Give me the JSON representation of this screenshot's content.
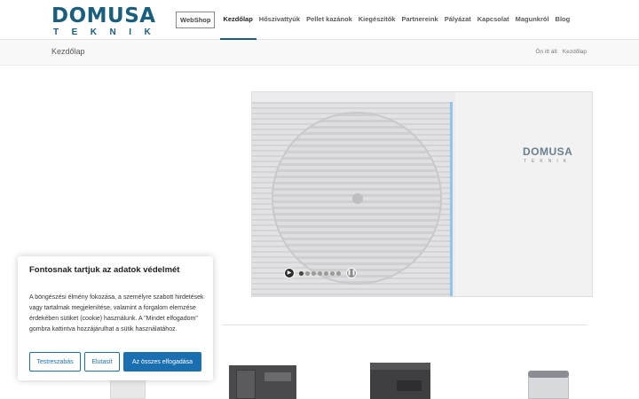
{
  "logo": {
    "main": "DOMUSA",
    "sub": "TEKNIK"
  },
  "nav": {
    "items": [
      {
        "label": "WebShop"
      },
      {
        "label": "Kezdőlap"
      },
      {
        "label": "Hőszivattyúk"
      },
      {
        "label": "Pellet kazánok"
      },
      {
        "label": "Kiegészítők"
      },
      {
        "label": "Partnereink"
      },
      {
        "label": "Pályázat"
      },
      {
        "label": "Kapcsolat"
      },
      {
        "label": "Magunkról"
      },
      {
        "label": "Blog"
      }
    ],
    "active": "Kezdőlap"
  },
  "title_bar": {
    "page_title": "Kezdőlap",
    "breadcrumb_prefix": "Ön itt áll:",
    "breadcrumb_current": "Kezdőlap"
  },
  "slider": {
    "brand_text": "DOMUSA",
    "brand_sub": "TEKNIK",
    "slide_count": 7,
    "active_slide": 1
  },
  "cookie": {
    "title": "Fontosnak tartjuk az adatok védelmét",
    "text": "A böngészési élmény fokozása, a személyre szabott hirdetések vagy tartalmak megjelenítése, valamint a forgalom elemzése érdekében sütiket (cookie) használunk. A \"Mindet elfogadom\" gombra kattintva hozzájárulhat a sütik használatához.",
    "btn_customize": "Testreszabás",
    "btn_reject": "Elutasít",
    "btn_accept_all": "Az összes elfogadása"
  },
  "colors": {
    "brand": "#1a5e7e",
    "accent": "#1a6fb0"
  }
}
